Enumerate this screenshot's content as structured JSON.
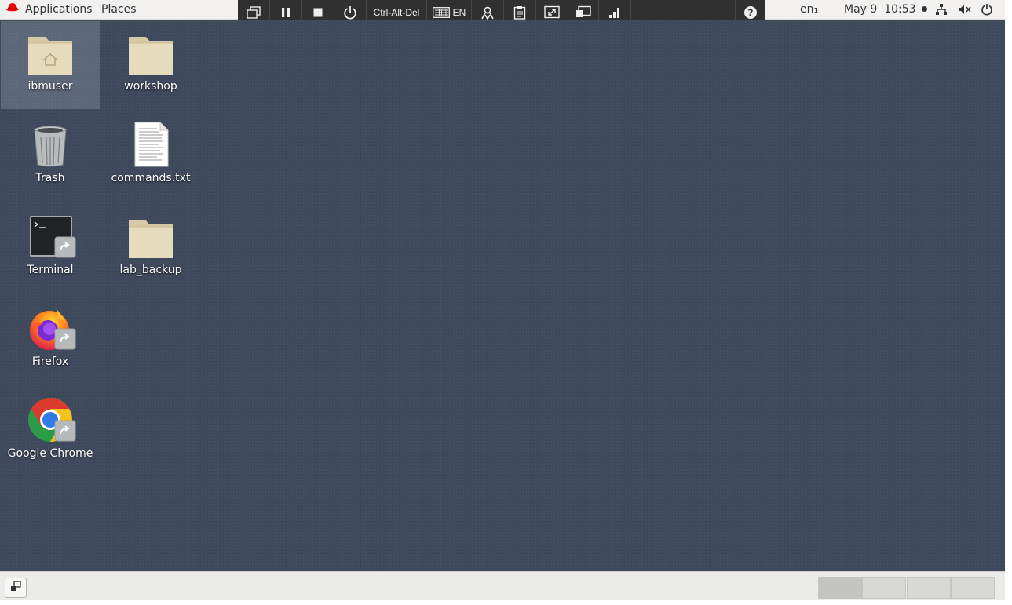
{
  "topbar": {
    "applications_label": "Applications",
    "places_label": "Places",
    "input_method": "en₁",
    "clock": "May 9  10:53",
    "icons": [
      "redhat-logo-icon",
      "network-icon",
      "volume-icon",
      "power-icon"
    ]
  },
  "vm_toolbar": {
    "ctrl_alt_del_label": "Ctrl-Alt-Del",
    "keyboard_layout_label": "EN",
    "icons": [
      "window-icon",
      "pause-icon",
      "stop-icon",
      "power-icon",
      "keyboard-icon",
      "users-icon",
      "clipboard-icon",
      "fullscreen-icon",
      "screens-icon",
      "signal-icon",
      "help-icon",
      "chevron-up-icon"
    ]
  },
  "desktop": {
    "icons": [
      {
        "label": "ibmuser",
        "kind": "home-folder-icon",
        "selected": true
      },
      {
        "label": "workshop",
        "kind": "folder-icon"
      },
      {
        "label": "Trash",
        "kind": "trash-icon"
      },
      {
        "label": "commands.txt",
        "kind": "text-file-icon"
      },
      {
        "label": "Terminal",
        "kind": "terminal-icon"
      },
      {
        "label": "lab_backup",
        "kind": "folder-icon"
      },
      {
        "label": "Firefox",
        "kind": "firefox-icon"
      },
      {
        "label": "Google Chrome",
        "kind": "chrome-icon"
      }
    ]
  },
  "bottombar": {
    "workspaces": 4,
    "active_workspace": 1
  },
  "colors": {
    "desktop": "#3e4a5c",
    "topbar": "#f2f1f0",
    "vm_toolbar": "#303030",
    "folder": "#e2d6b8",
    "redhat": "#ee0000"
  }
}
